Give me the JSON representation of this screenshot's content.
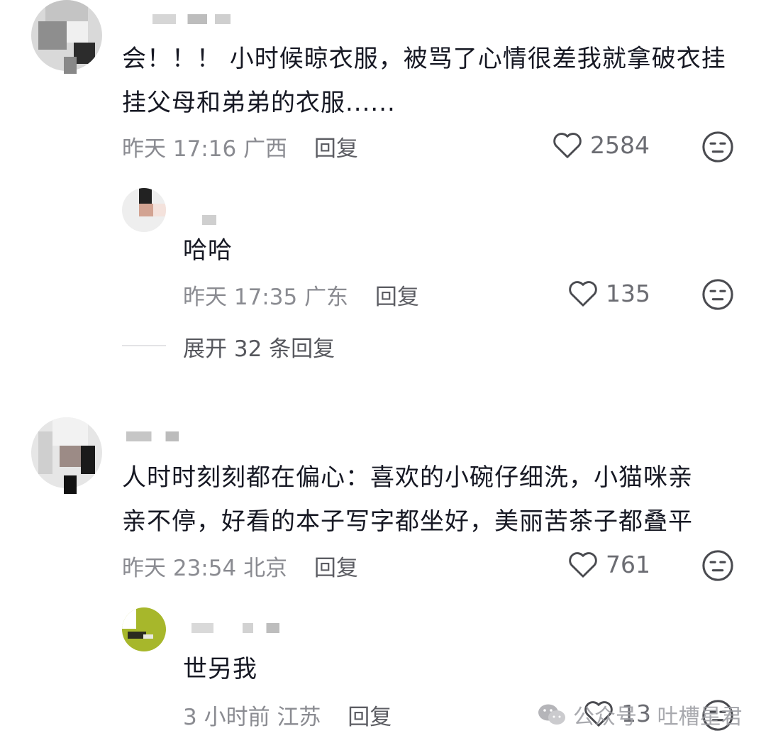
{
  "comments": [
    {
      "text_line1": "会！！！ 小时候晾衣服，被骂了心情很差我就拿破衣挂",
      "text_line2": "挂父母和弟弟的衣服......",
      "time": "昨天 17:16",
      "location": "广西",
      "reply_label": "回复",
      "likes": "2584",
      "replies": [
        {
          "text": "哈哈",
          "time": "昨天 17:35",
          "location": "广东",
          "reply_label": "回复",
          "likes": "135"
        }
      ],
      "expand_label": "展开 32 条回复"
    },
    {
      "text_line1": "人时时刻刻都在偏心：喜欢的小碗仔细洗，小猫咪亲",
      "text_line2": "亲不停，好看的本子写字都坐好，美丽苦茶子都叠平",
      "time": "昨天 23:54",
      "location": "北京",
      "reply_label": "回复",
      "likes": "761",
      "replies": [
        {
          "text": "世另我",
          "time": "3 小时前",
          "location": "江苏",
          "reply_label": "回复",
          "likes": "13"
        }
      ]
    }
  ],
  "watermark": {
    "text": "公众号 · 吐槽星君",
    "icon": "wechat-icon"
  },
  "icons": {
    "like": "heart-outline-icon",
    "dislike": "meh-face-icon"
  },
  "colors": {
    "text": "#161823",
    "meta": "#8a8b91",
    "icon": "#4a4b50"
  }
}
